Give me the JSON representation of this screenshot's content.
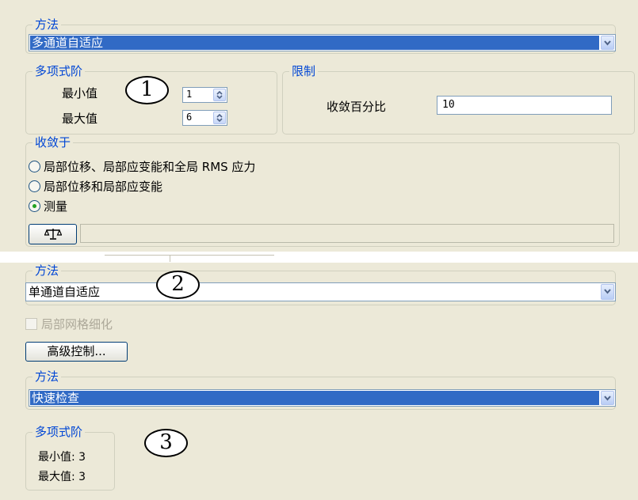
{
  "panel1": {
    "method_legend": "方法",
    "method_value": "多通道自适应",
    "poly_legend": "多项式阶",
    "min_label": "最小值",
    "min_value": "1",
    "max_label": "最大值",
    "max_value": "6",
    "limit_legend": "限制",
    "converge_pct_label": "收敛百分比",
    "converge_pct_value": "10",
    "converge_legend": "收敛于",
    "options": [
      "局部位移、局部应变能和全局 RMS 应力",
      "局部位移和局部应变能",
      "测量"
    ],
    "selected_option": "测量",
    "callout": "1"
  },
  "panel2": {
    "method_legend": "方法",
    "method_value": "单通道自适应",
    "local_refine_label": "局部网格细化",
    "advanced_button": "高级控制...",
    "callout": "2"
  },
  "panel3": {
    "method_legend": "方法",
    "method_value": "快速检查",
    "poly_legend": "多项式阶",
    "min_text": "最小值: 3",
    "max_text": "最大值: 3",
    "callout": "3"
  },
  "icons": {
    "measure": "measure-scale-icon",
    "dropdown": "chevron-down-icon",
    "spin": "spin-arrows-icon"
  }
}
